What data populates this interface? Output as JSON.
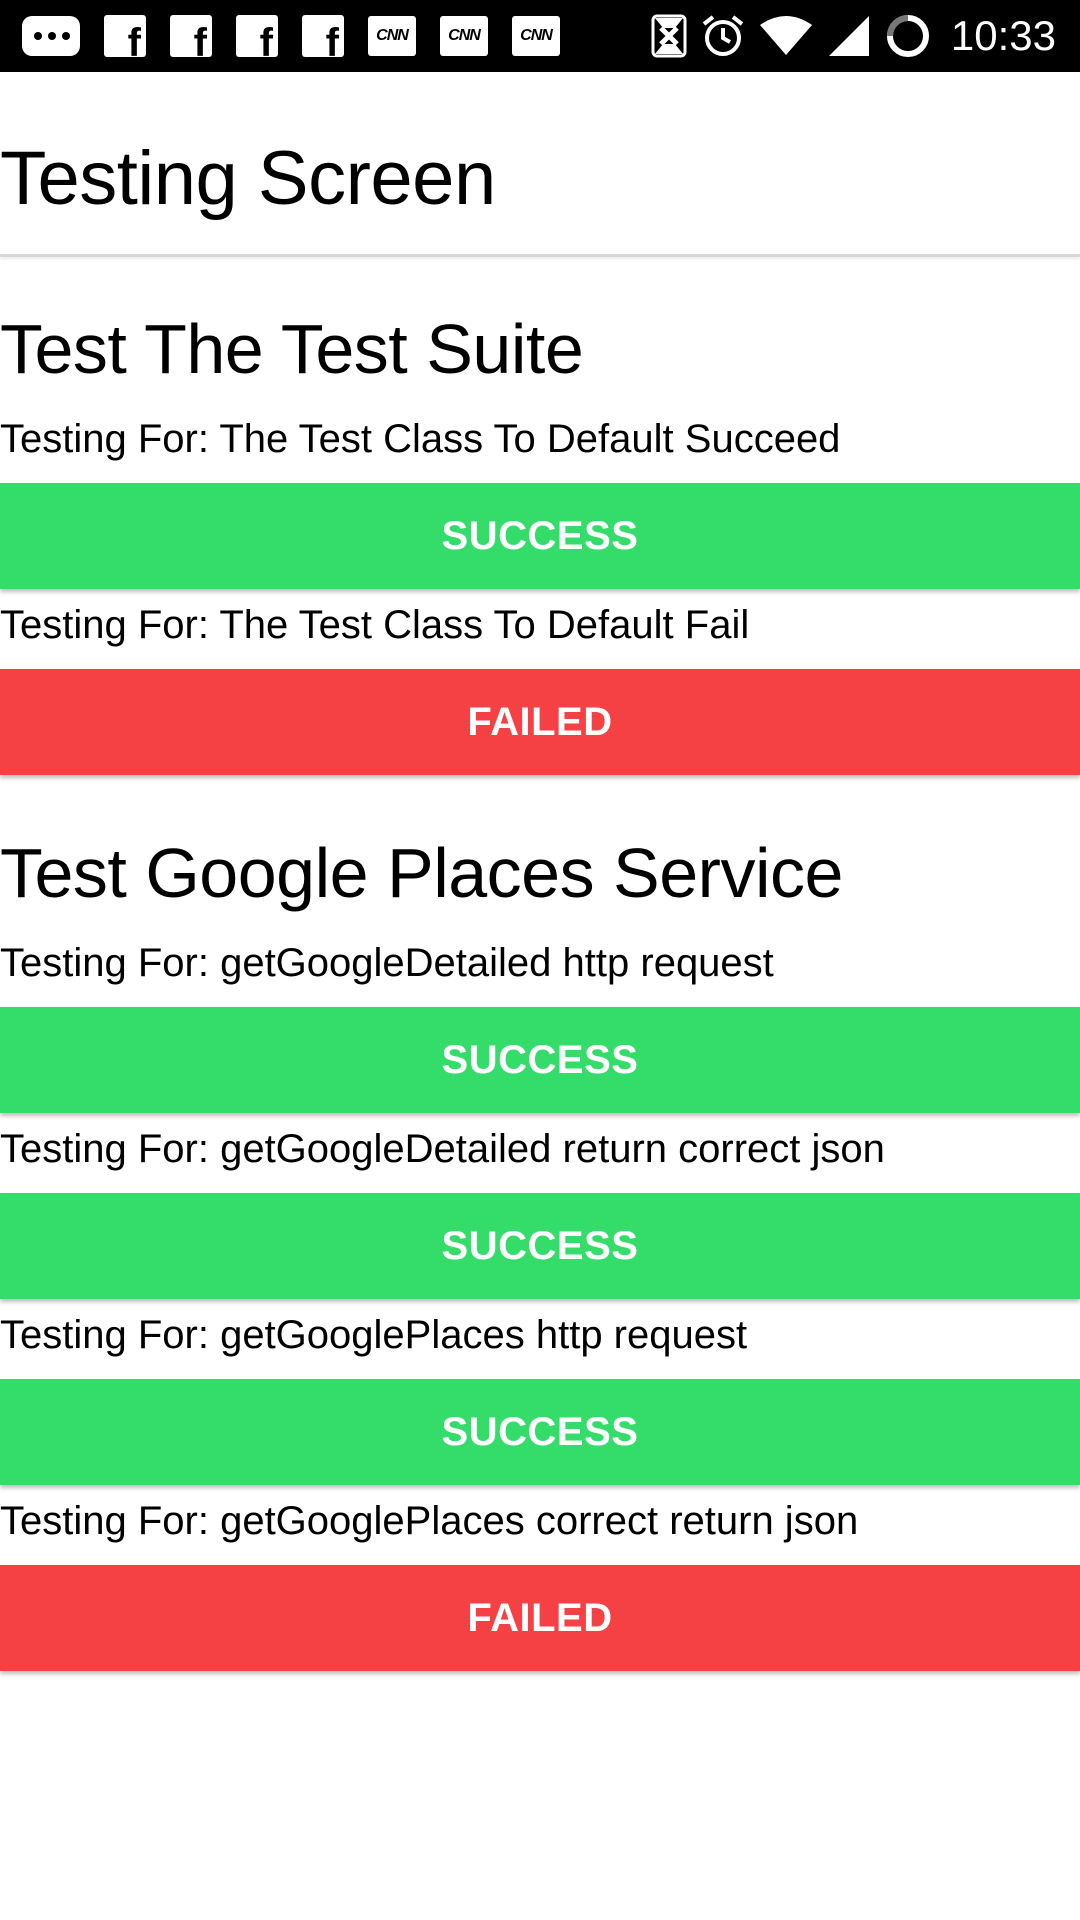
{
  "status_bar": {
    "time": "10:33",
    "notification_icons": [
      {
        "icon": "message-icon"
      },
      {
        "icon": "facebook-icon",
        "glyph": "f"
      },
      {
        "icon": "facebook-icon",
        "glyph": "f"
      },
      {
        "icon": "facebook-icon",
        "glyph": "f"
      },
      {
        "icon": "facebook-icon",
        "glyph": "f"
      },
      {
        "icon": "cnn-icon",
        "glyph": "CNN"
      },
      {
        "icon": "cnn-icon",
        "glyph": "CNN"
      },
      {
        "icon": "cnn-icon",
        "glyph": "CNN"
      }
    ],
    "system_icons": [
      "sync-icon",
      "alarm-icon",
      "wifi-icon",
      "signal-icon",
      "loading-icon"
    ]
  },
  "app_bar": {
    "title": "Testing Screen"
  },
  "colors": {
    "success": "#34dd6a",
    "failed": "#f54144",
    "divider": "#d8d8d8"
  },
  "sections": [
    {
      "title": "Test The Test Suite",
      "tests": [
        {
          "label": "Testing For: The Test Class To Default Succeed",
          "result": "SUCCESS",
          "status": "success"
        },
        {
          "label": "Testing For: The Test Class To Default Fail",
          "result": "FAILED",
          "status": "failed"
        }
      ]
    },
    {
      "title": "Test Google Places Service",
      "tests": [
        {
          "label": "Testing For: getGoogleDetailed http request",
          "result": "SUCCESS",
          "status": "success"
        },
        {
          "label": "Testing For: getGoogleDetailed return correct json",
          "result": "SUCCESS",
          "status": "success"
        },
        {
          "label": "Testing For: getGooglePlaces http request",
          "result": "SUCCESS",
          "status": "success"
        },
        {
          "label": "Testing For: getGooglePlaces correct return json",
          "result": "FAILED",
          "status": "failed"
        }
      ]
    }
  ]
}
